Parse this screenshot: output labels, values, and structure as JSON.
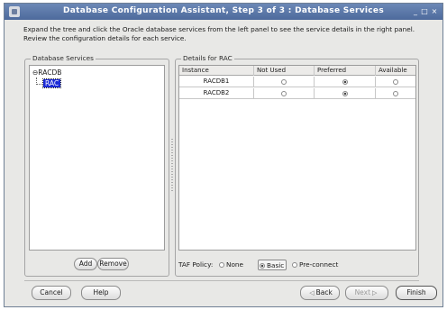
{
  "window": {
    "title": "Database Configuration Assistant, Step 3 of 3 : Database Services",
    "controls": {
      "minimize": "_",
      "maximize": "□",
      "close": "×"
    }
  },
  "instructions": "Expand the tree and click the Oracle database services from the left panel to see the service details in the right panel. Review the configuration details for each service.",
  "left_panel": {
    "legend": "Database Services",
    "tree": {
      "root": "RACDB",
      "root_prefix": "⊖",
      "child": "RAC"
    },
    "add_label": "Add",
    "remove_label": "Remove"
  },
  "right_panel": {
    "legend": "Details for RAC",
    "columns": [
      "Instance",
      "Not Used",
      "Preferred",
      "Available"
    ],
    "rows": [
      {
        "instance": "RACDB1",
        "selected": "Preferred"
      },
      {
        "instance": "RACDB2",
        "selected": "Preferred"
      }
    ],
    "taf_label": "TAF Policy:",
    "taf_options": [
      "None",
      "Basic",
      "Pre-connect"
    ],
    "taf_selected": "Basic"
  },
  "footer": {
    "cancel": "Cancel",
    "help": "Help",
    "back": "Back",
    "next": "Next",
    "finish": "Finish"
  },
  "colors": {
    "title_bar": "#5a77a8",
    "tree_selection": "#1c2bd6"
  }
}
